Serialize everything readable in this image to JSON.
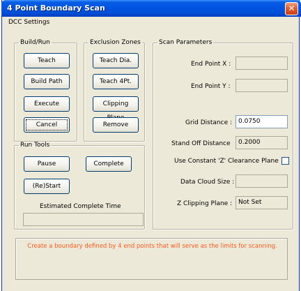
{
  "window": {
    "title": "4 Point Boundary Scan"
  },
  "menu": {
    "dcc_settings": "DCC Settings"
  },
  "build_run": {
    "legend": "Build/Run",
    "teach": "Teach",
    "build_path": "Build Path",
    "execute": "Execute",
    "cancel": "Cancel"
  },
  "exclusion_zones": {
    "legend": "Exclusion Zones",
    "teach_dia": "Teach Dia.",
    "teach_4pt": "Teach 4Pt.",
    "clipping_plane": "Clipping Plane",
    "remove": "Remove"
  },
  "run_tools": {
    "legend": "Run Tools",
    "pause": "Pause",
    "complete": "Complete",
    "restart": "(Re)Start",
    "estimated_label": "Estimated Complete Time",
    "estimated_value": ""
  },
  "scan_parameters": {
    "legend": "Scan Parameters",
    "end_point_x_label": "End Point X :",
    "end_point_x": "",
    "end_point_y_label": "End Point Y :",
    "end_point_y": "",
    "grid_distance_label": "Grid Distance :",
    "grid_distance": "0.0750",
    "standoff_label": "Stand Off Distance",
    "standoff": "0.2000",
    "use_constant_z_label": "Use Constant 'Z' Clearance Plane",
    "data_cloud_label": "Data Cloud Size :",
    "data_cloud": "",
    "z_clipping_label": "Z Clipping Plane :",
    "z_clipping": "Not Set"
  },
  "status": {
    "message": "Create a boundary defined by 4 end points that will serve as the limits for scanning.",
    "color": "#ff5a1e"
  }
}
